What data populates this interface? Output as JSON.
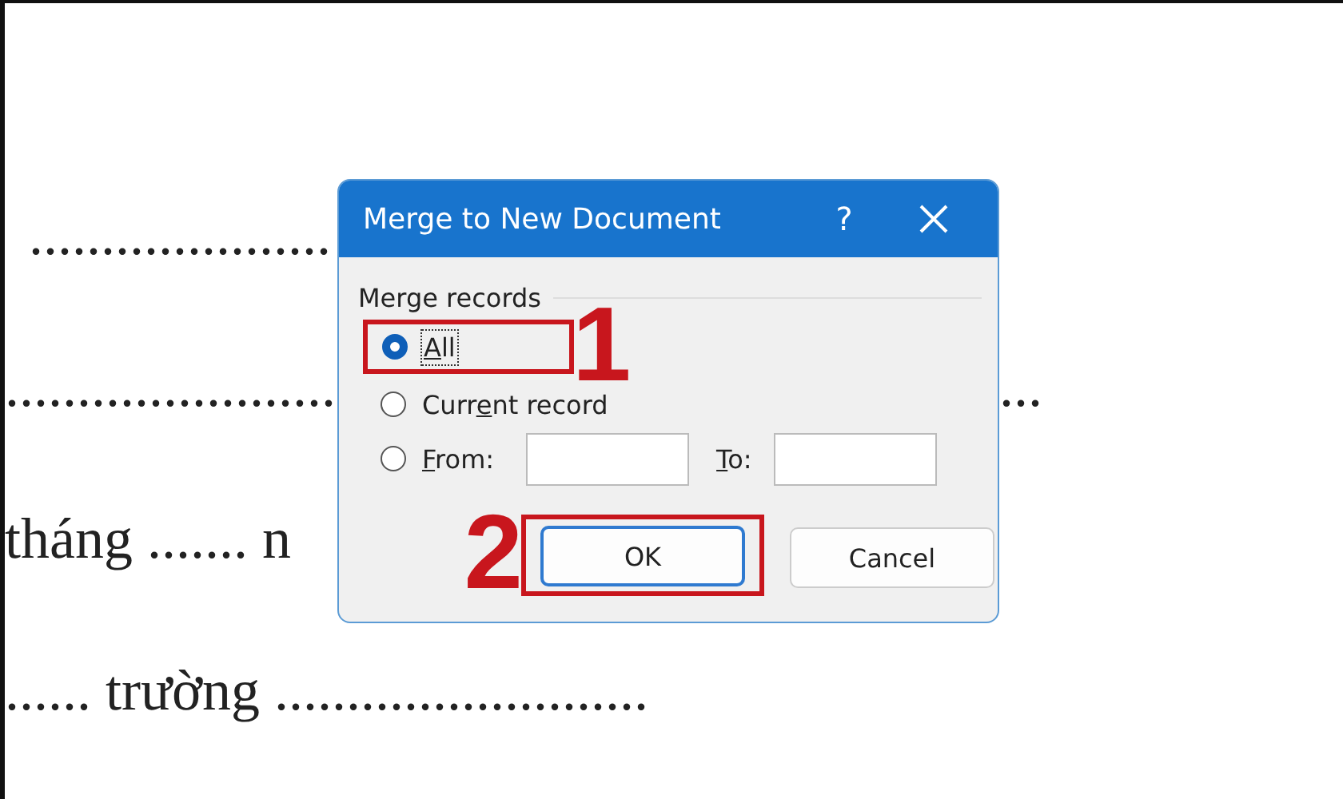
{
  "document": {
    "lines": [
      {
        "left": "....................."
      },
      {
        "left": ".......................",
        "right": "..."
      },
      {
        "left": "tháng ....... n"
      },
      {
        "left": "...... trường .........................."
      }
    ]
  },
  "dialog": {
    "title": "Merge to New Document",
    "help": "?",
    "group_label": "Merge records",
    "options": [
      {
        "kind": "plain",
        "key": "A",
        "after": "ll",
        "selected": true,
        "focused": true,
        "callout": "1"
      },
      {
        "kind": "plain",
        "before": "Curr",
        "key": "e",
        "after": "nt record",
        "selected": false,
        "focused": false
      },
      {
        "kind": "range",
        "key": "F",
        "after": "rom:",
        "selected": false,
        "focused": false
      }
    ],
    "range_to": {
      "key": "T",
      "after": "o:"
    },
    "buttons": [
      {
        "label": "OK",
        "default": true,
        "callout": "2"
      },
      {
        "label": "Cancel",
        "default": false
      }
    ]
  }
}
